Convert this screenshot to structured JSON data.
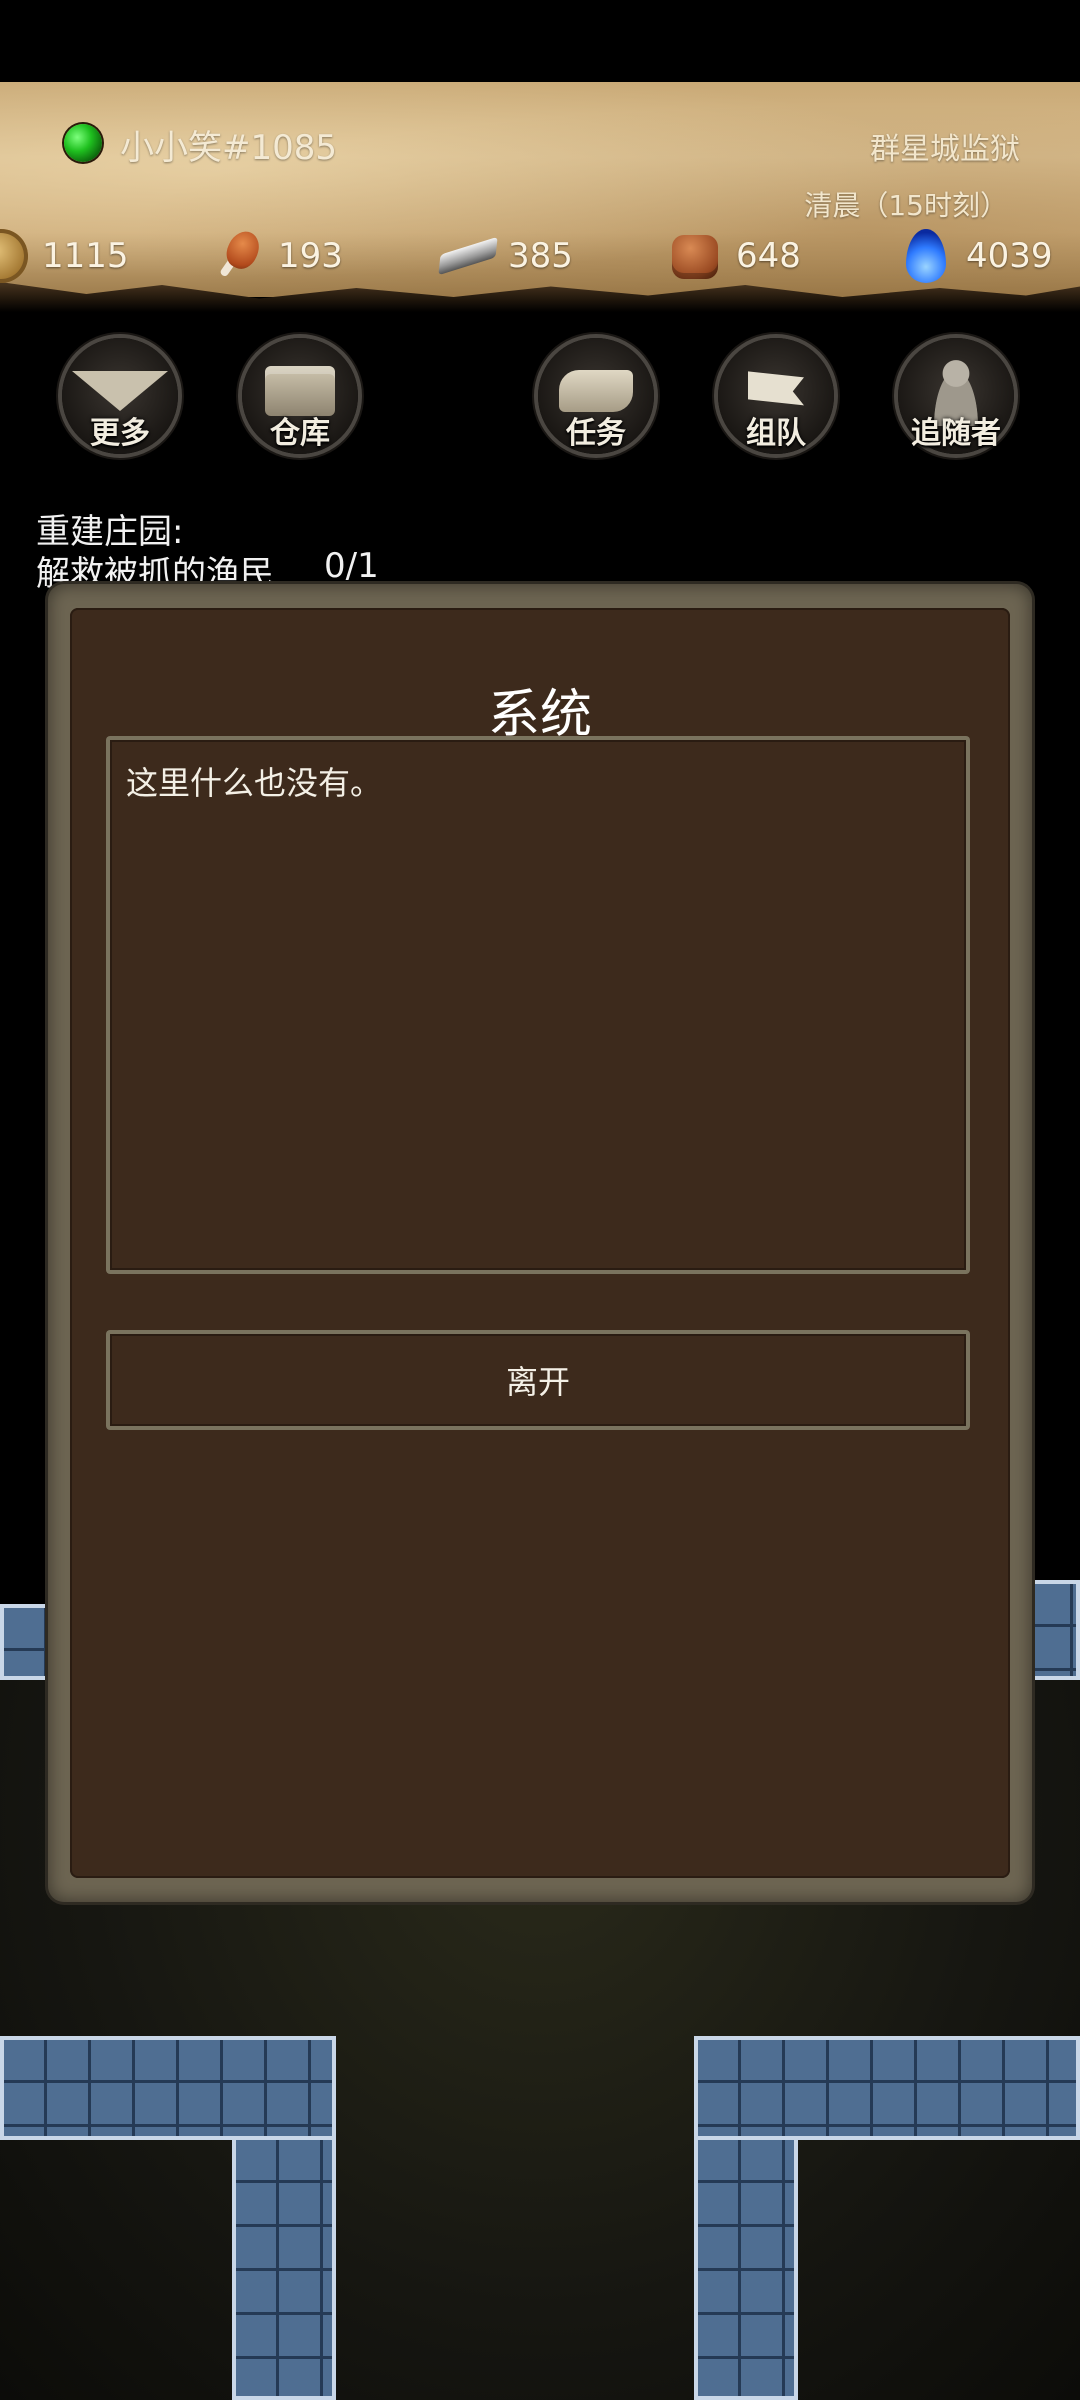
{
  "header": {
    "player_name": "小小笑#1085",
    "location": "群星城监狱",
    "time": "清晨（15时刻）"
  },
  "resources": [
    {
      "icon": "coin-icon",
      "value": "1115"
    },
    {
      "icon": "meat-icon",
      "value": "193"
    },
    {
      "icon": "iron-ingot-icon",
      "value": "385"
    },
    {
      "icon": "brick-icon",
      "value": "648"
    },
    {
      "icon": "blue-flame-icon",
      "value": "4039"
    }
  ],
  "nav": {
    "more": "更多",
    "warehouse": "仓库",
    "tasks": "任务",
    "team": "组队",
    "followers": "追随者"
  },
  "quest": {
    "title": "重建庄园:",
    "objective": "解救被抓的渔民",
    "progress": "0/1"
  },
  "dialog": {
    "title": "系统",
    "message": "这里什么也没有。",
    "leave_button": "离开"
  },
  "colors": {
    "panel_brown": "#3d2a1c",
    "frame_stone": "#6d6552",
    "parchment": "#d9bd8e",
    "tile_blue": "#4f6e92"
  }
}
